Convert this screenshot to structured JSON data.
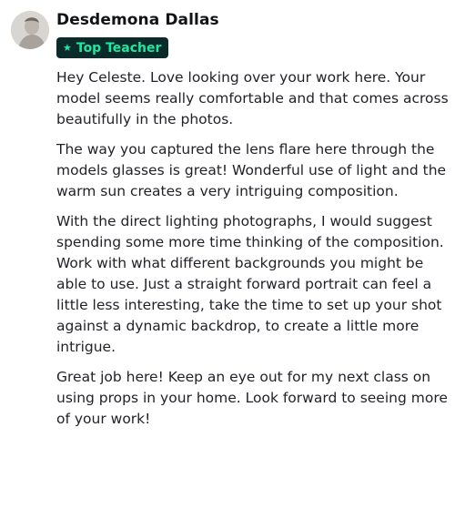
{
  "author": {
    "name": "Desdemona Dallas",
    "badge": "Top Teacher",
    "badge_icon": "star-icon",
    "badge_bg": "#0b2a2a",
    "badge_color": "#1ee8a0"
  },
  "comment": {
    "paragraphs": [
      "Hey Celeste. Love looking over your work here. Your model seems really comfortable and that comes across beautifully in the photos.",
      "The way you captured the lens flare here through the models glasses is great! Wonderful use of light and the warm sun creates a very intriguing composition.",
      "With the direct lighting photographs, I would suggest spending some more time thinking of the composition. Work with what different backgrounds you might be able to use. Just a straight forward portrait can feel a little less interesting, take the time to set up your shot against a dynamic backdrop, to create a little more intrigue.",
      "Great job here! Keep an eye out for my next class on using props in your home. Look forward to seeing more of your work!"
    ]
  }
}
